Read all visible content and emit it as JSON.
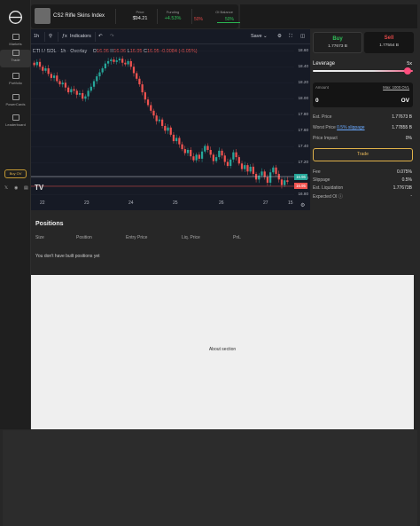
{
  "sidebar": {
    "items": [
      {
        "label": "Markets",
        "icon": "markets-icon"
      },
      {
        "label": "Trade",
        "icon": "trade-icon"
      },
      {
        "label": "Portfolio",
        "icon": "portfolio-icon"
      },
      {
        "label": "PowerCards",
        "icon": "powercards-icon"
      },
      {
        "label": "Leaderboard",
        "icon": "leaderboard-icon"
      }
    ],
    "buy_ov": "Buy OV",
    "social": [
      "X",
      "discord",
      "docs"
    ]
  },
  "header": {
    "market_name": "CS2 Rifle Skins Index",
    "price_label": "Price",
    "price_value": "$94.21",
    "funding_label": "Funding",
    "funding_value": "+4.53%",
    "oi_label": "OI Balance",
    "oi_short": "50%",
    "oi_long": "50%"
  },
  "chart_toolbar": {
    "interval": "1h",
    "indicators": "Indicators",
    "save": "Save"
  },
  "chart_legend": {
    "symbol": "ETH / SOL · 1h · Overlay",
    "o": "O",
    "o_val": "16.96",
    "h": "H",
    "h_val": "16.96",
    "l": "L",
    "l_val": "16.95",
    "c": "C",
    "c_val": "16.95",
    "change": "-0.0084 (-0.05%)"
  },
  "chart_data": {
    "type": "candlestick",
    "title": "ETH / SOL · 1h · Overlay",
    "x_ticks": [
      "22",
      "23",
      "24",
      "25",
      "26",
      "27",
      "15"
    ],
    "y_ticks": [
      "18.60",
      "18.40",
      "18.20",
      "18.00",
      "17.80",
      "17.60",
      "17.40",
      "17.20",
      "17.00",
      "16.80"
    ],
    "ylim": [
      16.75,
      18.68
    ],
    "close_series": [
      18.42,
      18.46,
      18.4,
      18.35,
      18.38,
      18.31,
      18.26,
      18.29,
      18.22,
      18.18,
      18.2,
      18.14,
      18.08,
      18.12,
      18.1,
      18.05,
      18.07,
      18.0,
      18.03,
      18.1,
      18.15,
      18.22,
      18.28,
      18.33,
      18.38,
      18.44,
      18.47,
      18.49,
      18.46,
      18.48,
      18.5,
      18.45,
      18.43,
      18.47,
      18.4,
      18.32,
      18.25,
      18.18,
      18.08,
      17.99,
      17.92,
      17.85,
      17.79,
      17.72,
      17.74,
      17.66,
      17.6,
      17.64,
      17.55,
      17.47,
      17.51,
      17.43,
      17.37,
      17.32,
      17.36,
      17.28,
      17.23,
      17.3,
      17.25,
      17.34,
      17.41,
      17.36,
      17.3,
      17.22,
      17.27,
      17.35,
      17.29,
      17.21,
      17.16,
      17.24,
      17.33,
      17.27,
      17.19,
      17.12,
      17.17,
      17.09,
      17.15,
      17.06,
      16.99,
      17.04,
      17.09,
      17.02,
      16.95,
      17.08,
      17.14,
      17.06,
      16.99,
      16.92,
      16.98,
      16.96
    ],
    "last_price": "16.95",
    "mark_price": "16.96"
  },
  "trade": {
    "buy_label": "Buy",
    "buy_price": "1.77673 B",
    "sell_label": "Sell",
    "sell_price": "1.77554 B",
    "leverage_label": "Leverage",
    "leverage_value": "5x",
    "leverage_fraction": 0.95,
    "amount_label": "Amount",
    "amount_max": "Max: 1000 OVL",
    "amount_value": "0",
    "amount_unit": "OV",
    "est_price_label": "Est. Price",
    "est_price_value": "1.77673 B",
    "worst_price_label": "Worst Price",
    "slippage_link": "0.5% slippage",
    "worst_price_value": "1.77855 B",
    "impact_label": "Price Impact",
    "impact_value": "0%",
    "trade_button": "Trade",
    "fee_label": "Fee",
    "fee_value": "0.075%",
    "slippage_label": "Slippage",
    "slippage_value": "0.5%",
    "liq_label": "Est. Liquidation",
    "liq_value": "1.77673B",
    "expected_oi_label": "Expected OI",
    "expected_oi_value": "-"
  },
  "positions": {
    "title": "Positions",
    "columns": [
      "Size",
      "Position",
      "Entry Price",
      "Liq. Price",
      "PnL"
    ],
    "empty": "You don't have built positions yet"
  },
  "about": {
    "text": "About section"
  },
  "colors": {
    "up": "#26a69a",
    "down": "#ef5350",
    "buy": "#31c05a",
    "sell": "#e04848",
    "accent": "#e0b24a"
  }
}
